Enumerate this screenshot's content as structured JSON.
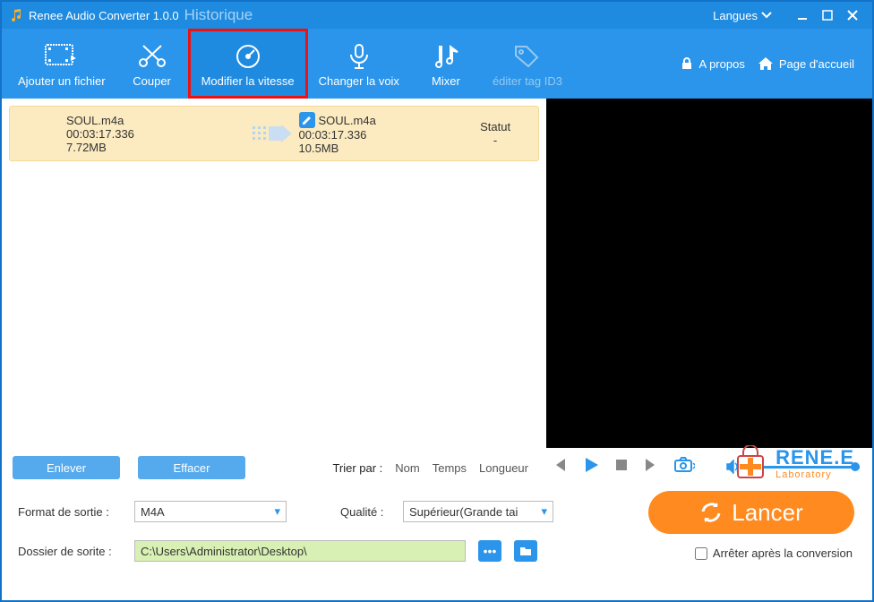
{
  "title": {
    "app": "Renee Audio Converter 1.0.0",
    "history": "Historique"
  },
  "titlebar": {
    "lang_label": "Langues"
  },
  "toolbar": {
    "add_file": "Ajouter un fichier",
    "cut": "Couper",
    "speed": "Modifier la vitesse",
    "voice": "Changer la voix",
    "mix": "Mixer",
    "id3": "éditer tag ID3",
    "about": "A propos",
    "home": "Page d'accueil"
  },
  "file": {
    "src_name": "SOUL.m4a",
    "src_duration": "00:03:17.336",
    "src_size": "7.72MB",
    "dst_name": "SOUL.m4a",
    "dst_duration": "00:03:17.336",
    "dst_size": "10.5MB",
    "status_header": "Statut",
    "status_value": "-"
  },
  "controls": {
    "remove": "Enlever",
    "clear": "Effacer",
    "sort_label": "Trier par :",
    "sort_name": "Nom",
    "sort_time": "Temps",
    "sort_length": "Longueur"
  },
  "bottom": {
    "format_label": "Format de sortie :",
    "format_value": "M4A",
    "quality_label": "Qualité :",
    "quality_value": "Supérieur(Grande tai",
    "folder_label": "Dossier de sorite :",
    "folder_value": "C:\\Users\\Administrator\\Desktop\\",
    "launch": "Lancer",
    "stop_after": "Arrêter après la conversion"
  },
  "brand": {
    "name_a": "RENE",
    "name_b": ".E",
    "lab": "Laboratory"
  }
}
